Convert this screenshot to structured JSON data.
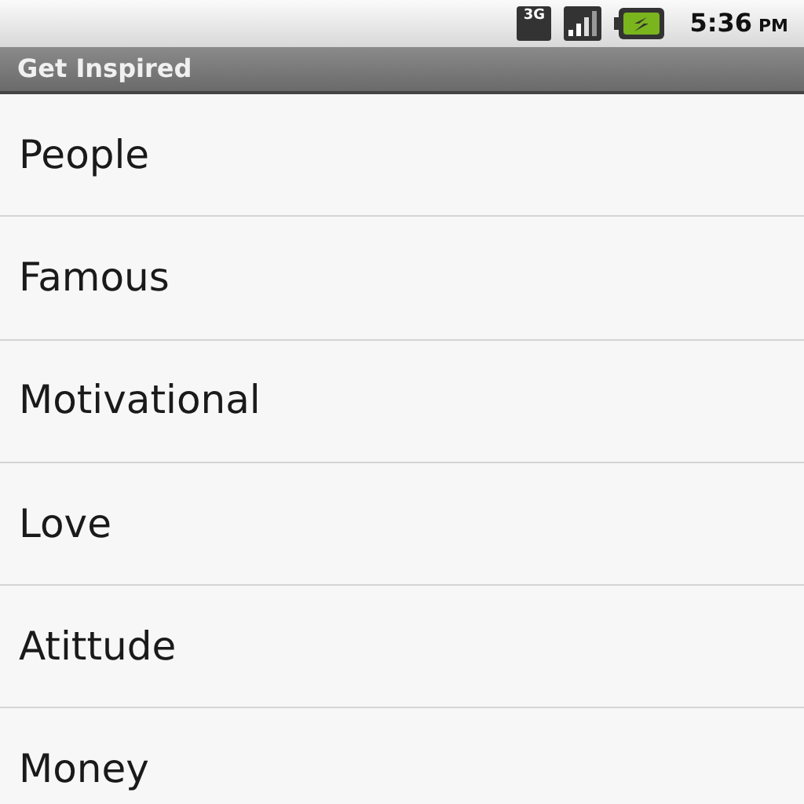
{
  "status_bar": {
    "network": "3G",
    "time": "5:36",
    "ampm": "PM"
  },
  "title_bar": {
    "title": "Get Inspired"
  },
  "list": {
    "items": [
      {
        "label": "People"
      },
      {
        "label": "Famous"
      },
      {
        "label": "Motivational"
      },
      {
        "label": "Love"
      },
      {
        "label": "Atittude"
      },
      {
        "label": "Money"
      }
    ]
  }
}
